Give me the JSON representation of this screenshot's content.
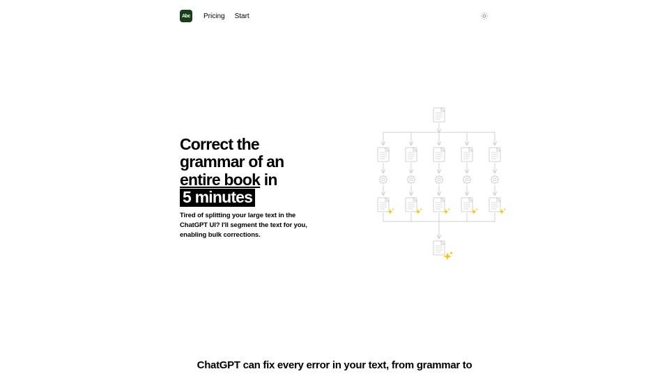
{
  "nav": {
    "pricing": "Pricing",
    "start": "Start"
  },
  "hero": {
    "h1_part1": "Correct the grammar of an ",
    "h1_underline": "entire book",
    "h1_part2": " in ",
    "h1_highlight": "5 minutes",
    "subtitle": "Tired of splitting your large text in the ChatGPT UI? I'll segment the text for you, enabling bulk corrections."
  },
  "section2": {
    "heading": "ChatGPT can fix every error in your text, from grammar to"
  },
  "colors": {
    "stroke": "#d0d0d0",
    "sparkle": "#f5c518"
  }
}
